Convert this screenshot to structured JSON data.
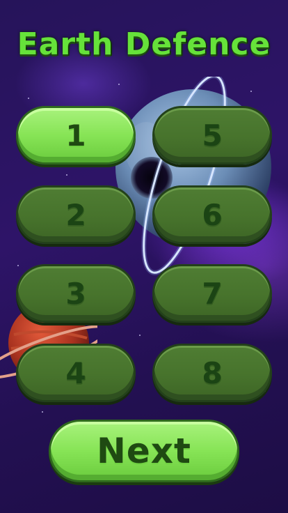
{
  "game": {
    "title": "Earth Defence",
    "levels": [
      {
        "label": "1",
        "selected": true
      },
      {
        "label": "2",
        "selected": false
      },
      {
        "label": "3",
        "selected": false
      },
      {
        "label": "4",
        "selected": false
      },
      {
        "label": "5",
        "selected": false
      },
      {
        "label": "6",
        "selected": false
      },
      {
        "label": "7",
        "selected": false
      },
      {
        "label": "8",
        "selected": false
      }
    ],
    "next_label": "Next"
  },
  "colors": {
    "title_green": "#66e23a",
    "button_dark": "#47732c",
    "button_selected": "#87e456",
    "background": "#2e1468"
  }
}
